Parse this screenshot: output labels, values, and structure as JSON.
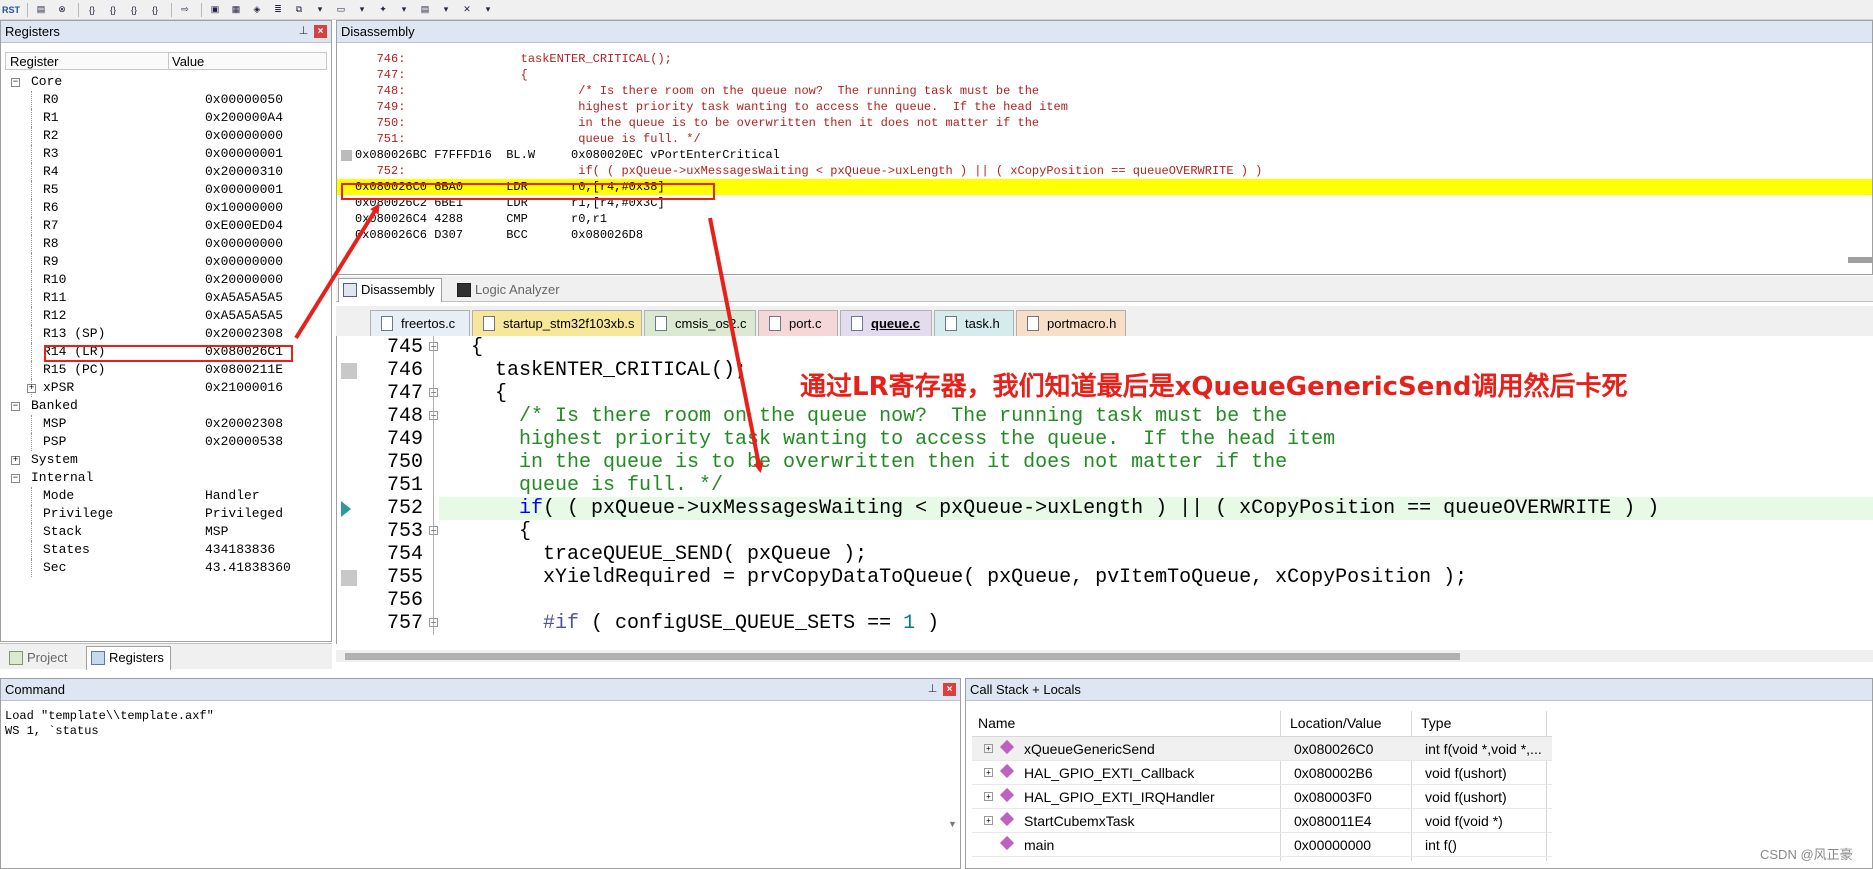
{
  "toolbar": {
    "buttons": [
      {
        "icon": "reset-icon",
        "label": "RST"
      },
      {
        "icon": "step-into-icon",
        "label": "{}"
      },
      {
        "icon": "step-over-icon",
        "label": "{}"
      },
      {
        "icon": "step-out-icon",
        "label": "{}"
      },
      {
        "icon": "run-to-cursor-icon",
        "label": "{}"
      },
      {
        "icon": "show-next-icon",
        "label": "⇨"
      }
    ]
  },
  "registers": {
    "title": "Registers",
    "col_register": "Register",
    "col_value": "Value",
    "groups": [
      {
        "name": "Core",
        "items": [
          {
            "name": "R0",
            "value": "0x00000050"
          },
          {
            "name": "R1",
            "value": "0x200000A4"
          },
          {
            "name": "R2",
            "value": "0x00000000"
          },
          {
            "name": "R3",
            "value": "0x00000001"
          },
          {
            "name": "R4",
            "value": "0x20000310"
          },
          {
            "name": "R5",
            "value": "0x00000001"
          },
          {
            "name": "R6",
            "value": "0x10000000"
          },
          {
            "name": "R7",
            "value": "0xE000ED04"
          },
          {
            "name": "R8",
            "value": "0x00000000"
          },
          {
            "name": "R9",
            "value": "0x00000000"
          },
          {
            "name": "R10",
            "value": "0x20000000"
          },
          {
            "name": "R11",
            "value": "0xA5A5A5A5"
          },
          {
            "name": "R12",
            "value": "0xA5A5A5A5"
          },
          {
            "name": "R13 (SP)",
            "value": "0x20002308"
          },
          {
            "name": "R14 (LR)",
            "value": "0x080026C1"
          },
          {
            "name": "R15 (PC)",
            "value": "0x0800211E"
          },
          {
            "name": "xPSR",
            "value": "0x21000016"
          }
        ]
      },
      {
        "name": "Banked",
        "items": [
          {
            "name": "MSP",
            "value": "0x20002308"
          },
          {
            "name": "PSP",
            "value": "0x20000538"
          }
        ]
      },
      {
        "name": "System",
        "items": []
      },
      {
        "name": "Internal",
        "items": [
          {
            "name": "Mode",
            "value": "Handler"
          },
          {
            "name": "Privilege",
            "value": "Privileged"
          },
          {
            "name": "Stack",
            "value": "MSP"
          },
          {
            "name": "States",
            "value": "434183836"
          },
          {
            "name": "Sec",
            "value": "43.41838360"
          }
        ]
      }
    ],
    "tabs": {
      "project": "Project",
      "registers": "Registers"
    }
  },
  "disassembly": {
    "title": "Disassembly",
    "lines": [
      {
        "text": "   746:                taskENTER_CRITICAL();",
        "kind": "src"
      },
      {
        "text": "   747:                {",
        "kind": "src"
      },
      {
        "text": "   748:                        /* Is there room on the queue now?  The running task must be the",
        "kind": "src"
      },
      {
        "text": "   749:                        highest priority task wanting to access the queue.  If the head item",
        "kind": "src"
      },
      {
        "text": "   750:                        in the queue is to be overwritten then it does not matter if the",
        "kind": "src"
      },
      {
        "text": "   751:                        queue is full. */",
        "kind": "src"
      },
      {
        "text": "0x080026BC F7FFFD16  BL.W     0x080020EC vPortEnterCritical",
        "kind": "asm"
      },
      {
        "text": "   752:                        if( ( pxQueue->uxMessagesWaiting < pxQueue->uxLength ) || ( xCopyPosition == queueOVERWRITE ) )",
        "kind": "src"
      },
      {
        "text": "0x080026C0 6BA0      LDR      r0,[r4,#0x38]",
        "kind": "hl"
      },
      {
        "text": "0x080026C2 6BE1      LDR      r1,[r4,#0x3C]",
        "kind": "asm"
      },
      {
        "text": "0x080026C4 4288      CMP      r0,r1",
        "kind": "asm"
      },
      {
        "text": "0x080026C6 D307      BCC      0x080026D8",
        "kind": "asm"
      }
    ],
    "tabs": {
      "disassembly": "Disassembly",
      "logic_analyzer": "Logic Analyzer"
    }
  },
  "file_tabs": [
    {
      "label": "freertos.c",
      "color": "#e8eef6",
      "active": false
    },
    {
      "label": "startup_stm32f103xb.s",
      "color": "#f7e79a",
      "active": false
    },
    {
      "label": "cmsis_os2.c",
      "color": "#dce9d2",
      "active": false
    },
    {
      "label": "port.c",
      "color": "#f5d7d7",
      "active": false
    },
    {
      "label": "queue.c",
      "color": "#e3dcef",
      "active": true
    },
    {
      "label": "task.h",
      "color": "#d6ecec",
      "active": false
    },
    {
      "label": "portmacro.h",
      "color": "#f6dfc6",
      "active": false
    }
  ],
  "editor": {
    "lines": [
      {
        "no": "745",
        "fold": "⊟",
        "code": "  {",
        "cls": "",
        "bp": false
      },
      {
        "no": "746",
        "fold": "",
        "code": "    taskENTER_CRITICAL();",
        "cls": "",
        "bp": true
      },
      {
        "no": "747",
        "fold": "⊟",
        "code": "    {",
        "cls": "",
        "bp": false
      },
      {
        "no": "748",
        "fold": "⊟",
        "code": "      /* Is there room on the queue now?  The running task must be the",
        "cls": "cmt",
        "bp": false
      },
      {
        "no": "749",
        "fold": "",
        "code": "      highest priority task wanting to access the queue.  If the head item",
        "cls": "cmt",
        "bp": false
      },
      {
        "no": "750",
        "fold": "",
        "code": "      in the queue is to be overwritten then it does not matter if the",
        "cls": "cmt",
        "bp": false
      },
      {
        "no": "751",
        "fold": "",
        "code": "      queue is full. */",
        "cls": "cmt",
        "bp": false
      },
      {
        "no": "752",
        "fold": "",
        "code": "      if( ( pxQueue->uxMessagesWaiting < pxQueue->uxLength ) || ( xCopyPosition == queueOVERWRITE ) )",
        "cls": "cur",
        "bp": false
      },
      {
        "no": "753",
        "fold": "⊟",
        "code": "      {",
        "cls": "",
        "bp": false
      },
      {
        "no": "754",
        "fold": "",
        "code": "        traceQUEUE_SEND( pxQueue );",
        "cls": "",
        "bp": false
      },
      {
        "no": "755",
        "fold": "",
        "code": "        xYieldRequired = prvCopyDataToQueue( pxQueue, pvItemToQueue, xCopyPosition );",
        "cls": "",
        "bp": true
      },
      {
        "no": "756",
        "fold": "",
        "code": "",
        "cls": "",
        "bp": false
      },
      {
        "no": "757",
        "fold": "⊟",
        "code": "        #if ( configUSE_QUEUE_SETS == 1 )",
        "cls": "pre",
        "bp": false
      }
    ]
  },
  "annotation": {
    "text": "通过LR寄存器，我们知道最后是xQueueGenericSend调用然后卡死"
  },
  "command": {
    "title": "Command",
    "lines": "Load \"template\\\\template.axf\"\nWS 1, `status"
  },
  "callstack": {
    "title": "Call Stack + Locals",
    "col_name": "Name",
    "col_location": "Location/Value",
    "col_type": "Type",
    "rows": [
      {
        "name": "xQueueGenericSend",
        "location": "0x080026C0",
        "type": "int f(void *,void *,...",
        "expandable": true
      },
      {
        "name": "HAL_GPIO_EXTI_Callback",
        "location": "0x080002B6",
        "type": "void f(ushort)",
        "expandable": true
      },
      {
        "name": "HAL_GPIO_EXTI_IRQHandler",
        "location": "0x080003F0",
        "type": "void f(ushort)",
        "expandable": true
      },
      {
        "name": "StartCubemxTask",
        "location": "0x080011E4",
        "type": "void f(void *)",
        "expandable": true
      },
      {
        "name": "main",
        "location": "0x00000000",
        "type": "int f()",
        "expandable": false
      }
    ]
  },
  "watermark": "CSDN @风正豪",
  "colors": {
    "highlight": "#ffff00",
    "annotation": "#e8201a",
    "comment": "#228b22",
    "keyword": "#0000ff"
  }
}
